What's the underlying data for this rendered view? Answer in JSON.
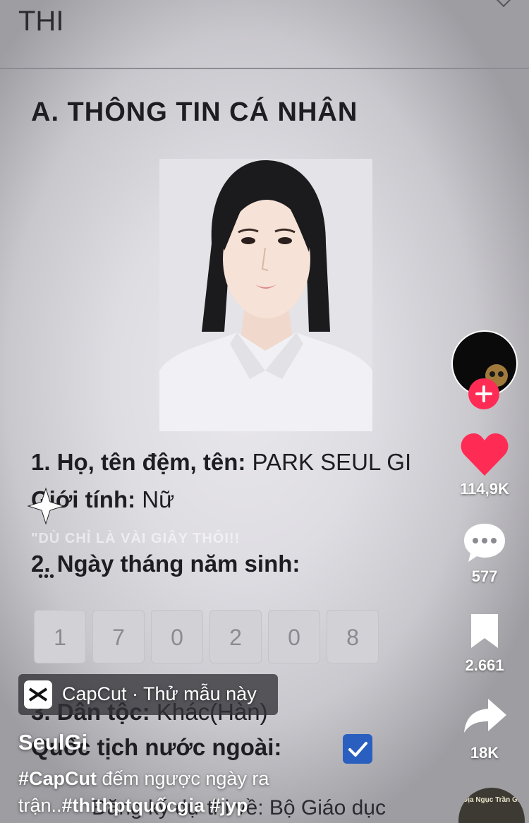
{
  "form": {
    "header_partial": "THI",
    "section_title": "A. THÔNG TIN CÁ NHÂN",
    "field1_label": "1. Họ, tên đệm, tên:",
    "field1_value": "PARK SEUL GI",
    "field_gender_label": "Giới tính:",
    "field_gender_value": "Nữ",
    "caption_faded": "\"DÙ CHỈ LÀ VÀI GIÂY THÔI!!",
    "field2_label": "2. Ngày tháng năm sinh:",
    "dob_digits": [
      "1",
      "7",
      "0",
      "2",
      "0",
      "8"
    ],
    "field3_label": "3. Dân tộc:",
    "field3_value": "Khác(Hàn)",
    "field_foreign_label": "Quốc tịch nước ngoài:",
    "field_bottom_partial": "Đăng ký dự thi về:",
    "field_bottom_value": "Bộ Giáo dục"
  },
  "sidebar": {
    "likes": "114,9K",
    "comments": "577",
    "saves": "2.661",
    "shares": "18K",
    "sound_label": "Địa Ngục Trần Gian"
  },
  "capcut": {
    "label": "CapCut · Thử mẫu này"
  },
  "post": {
    "username": "SeulGi",
    "caption_line1_tag": "#CapCut",
    "caption_line1_text": " đếm ngược ngày ra",
    "caption_line2_text": "trận..",
    "caption_line2_tags": "#thithptquốcgia #jyp"
  },
  "colors": {
    "like_red": "#fe2c55",
    "checkbox_blue": "#2a5fc0"
  },
  "icons": [
    "heart-icon",
    "comment-icon",
    "bookmark-icon",
    "share-icon",
    "plus-icon",
    "check-icon",
    "capcut-logo-icon",
    "sparkle-icon"
  ]
}
